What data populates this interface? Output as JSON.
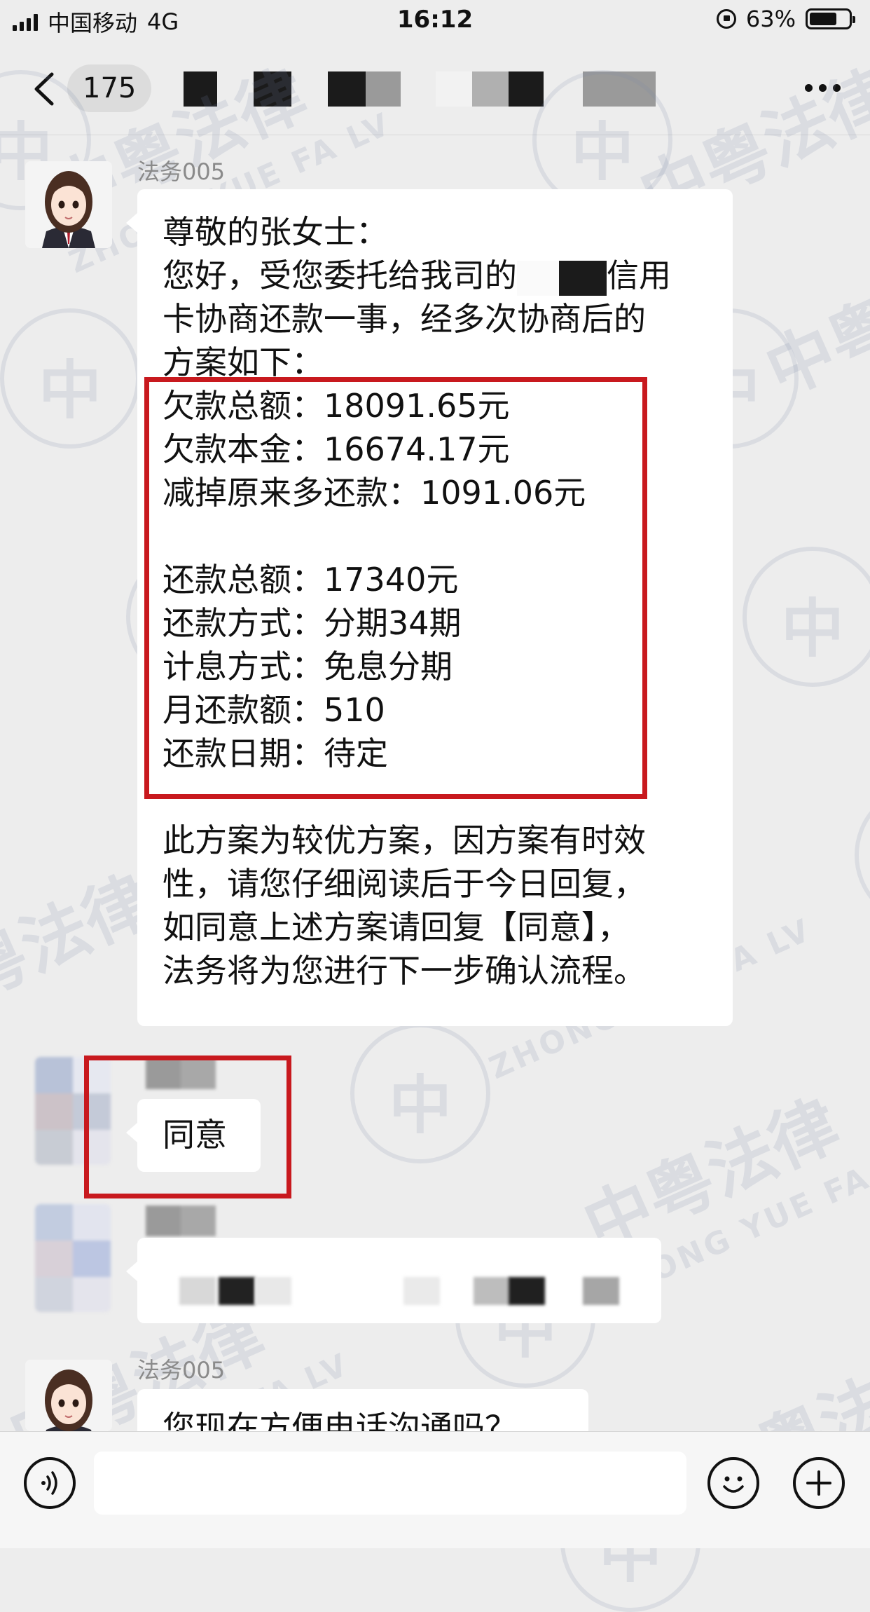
{
  "status_bar": {
    "carrier": "中国移动",
    "network": "4G",
    "time": "16:12",
    "battery_percent": "63%",
    "battery_level": 0.63
  },
  "nav": {
    "back_count": "175",
    "title_redacted": true
  },
  "messages": {
    "m1": {
      "sender": "法务005",
      "lines": [
        "尊敬的张女士：",
        "您好，受您委托给我司的",
        "信用",
        "卡协商还款一事，经多次协商后的",
        "方案如下："
      ],
      "plan": [
        "欠款总额：18091.65元",
        "欠款本金：16674.17元",
        "减掉原来多还款：1091.06元",
        "还款总额：17340元",
        "还款方式：分期34期",
        "计息方式：免息分期",
        "月还款额：510",
        "还款日期：待定"
      ],
      "closing": [
        "此方案为较优方案，因方案有时效",
        "性，请您仔细阅读后于今日回复，",
        "如同意上述方案请回复【同意】，",
        "法务将为您进行下一步确认流程。"
      ]
    },
    "m2": {
      "text": "同意"
    },
    "m4": {
      "sender": "法务005",
      "text": "您现在方便电话沟通吗？"
    }
  },
  "watermark": {
    "brand": "中粤法律",
    "brand_en": "ZHONG YUE FA LV",
    "seal_char": "中"
  },
  "colors": {
    "background": "#ededed",
    "bubble": "#ffffff",
    "highlight_box": "#c8191e",
    "watermark": "#7a88a8"
  },
  "icons": [
    "back-chevron-icon",
    "more-icon",
    "voice-icon",
    "emoji-icon",
    "plus-icon"
  ]
}
